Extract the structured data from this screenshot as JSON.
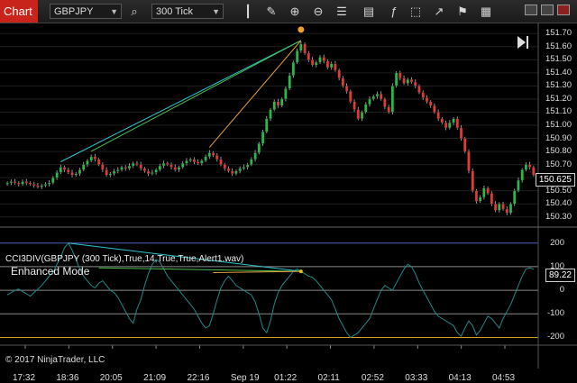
{
  "toolbar": {
    "tab_label": "Chart",
    "instrument": "GBPJPY",
    "interval": "300 Tick"
  },
  "colors": {
    "background": "#000000",
    "up_candle": "#2db84a",
    "down_candle": "#e53935",
    "oscillator": "#1d8a8a",
    "divergence_cyan": "#2cc6d0",
    "divergence_green": "#49c04a",
    "divergence_orange": "#e8a040",
    "level_200": "#5060c0",
    "level_minus200": "#d4a020",
    "accent": "#c9241c"
  },
  "price_axis": {
    "labels": [
      "151.70",
      "151.60",
      "151.50",
      "151.40",
      "151.30",
      "151.20",
      "151.10",
      "151.00",
      "150.90",
      "150.80",
      "150.70",
      "150.60",
      "150.50",
      "150.40",
      "150.30"
    ],
    "current_price": "150.625"
  },
  "indicator": {
    "title": "CCI3DIV(GBPJPY (300 Tick),True,14,True,True,Alert1.wav)",
    "mode": "Enhanced Mode",
    "levels": [
      "200",
      "100",
      "0",
      "-100",
      "-200"
    ],
    "current_value": "89.22"
  },
  "time_axis": {
    "labels": [
      "17:32",
      "18:36",
      "20:05",
      "21:09",
      "22:16",
      "Sep 19",
      "01:22",
      "02:11",
      "02:52",
      "03:33",
      "04:13",
      "04:53"
    ]
  },
  "copyright": "© 2017 NinjaTrader, LLC",
  "chart_data": {
    "type": "candlestick",
    "instrument": "GBPJPY",
    "ylim": [
      150.25,
      151.75
    ],
    "closes": [
      150.56,
      150.57,
      150.56,
      150.55,
      150.57,
      150.56,
      150.55,
      150.54,
      150.53,
      150.54,
      150.55,
      150.56,
      150.6,
      150.64,
      150.68,
      150.66,
      150.64,
      150.62,
      150.63,
      150.66,
      150.7,
      150.73,
      150.76,
      150.74,
      150.7,
      150.66,
      150.62,
      150.63,
      150.65,
      150.66,
      150.68,
      150.67,
      150.69,
      150.71,
      150.7,
      150.67,
      150.65,
      150.63,
      150.64,
      150.66,
      150.69,
      150.71,
      150.7,
      150.68,
      150.66,
      150.68,
      150.71,
      150.73,
      150.74,
      150.72,
      150.71,
      150.73,
      150.76,
      150.79,
      150.77,
      150.74,
      150.7,
      150.67,
      150.65,
      150.63,
      150.65,
      150.67,
      150.68,
      150.7,
      150.74,
      150.79,
      150.86,
      150.95,
      151.05,
      151.12,
      151.18,
      151.15,
      151.2,
      151.28,
      151.38,
      151.48,
      151.57,
      151.62,
      151.55,
      151.5,
      151.46,
      151.48,
      151.52,
      151.49,
      151.44,
      151.47,
      151.42,
      151.36,
      151.3,
      151.26,
      151.18,
      151.12,
      151.05,
      151.1,
      151.16,
      151.2,
      151.22,
      151.24,
      151.2,
      151.14,
      151.1,
      151.3,
      151.4,
      151.36,
      151.32,
      151.35,
      151.33,
      151.3,
      151.25,
      151.21,
      151.18,
      151.15,
      151.1,
      151.05,
      151.02,
      150.98,
      151.02,
      151.05,
      150.98,
      150.9,
      150.8,
      150.65,
      150.5,
      150.42,
      150.45,
      150.52,
      150.48,
      150.4,
      150.35,
      150.4,
      150.36,
      150.33,
      150.4,
      150.5,
      150.58,
      150.66,
      150.7,
      150.68,
      150.62
    ],
    "oscillator": [
      -20,
      -10,
      0,
      5,
      -5,
      -15,
      -25,
      -10,
      5,
      20,
      40,
      60,
      75,
      110,
      140,
      180,
      200,
      170,
      130,
      90,
      60,
      40,
      20,
      10,
      30,
      40,
      20,
      0,
      -10,
      -30,
      -60,
      -90,
      -120,
      -140,
      -80,
      -40,
      20,
      70,
      110,
      130,
      120,
      90,
      60,
      40,
      20,
      0,
      -20,
      -40,
      -60,
      -80,
      -110,
      -140,
      -160,
      -150,
      -100,
      -40,
      10,
      40,
      60,
      40,
      20,
      10,
      0,
      -10,
      -20,
      -50,
      -100,
      -160,
      -180,
      -130,
      -60,
      -10,
      20,
      40,
      60,
      80,
      90,
      80,
      70,
      60,
      55,
      40,
      20,
      0,
      -20,
      -40,
      -80,
      -120,
      -150,
      -180,
      -200,
      -190,
      -180,
      -160,
      -140,
      -120,
      -80,
      -40,
      0,
      20,
      10,
      0,
      30,
      60,
      90,
      110,
      100,
      70,
      30,
      0,
      -30,
      -60,
      -90,
      -110,
      -120,
      -130,
      -140,
      -150,
      -180,
      -195,
      -160,
      -130,
      -150,
      -190,
      -170,
      -140,
      -110,
      -120,
      -140,
      -160,
      -120,
      -90,
      -60,
      -20,
      20,
      60,
      90,
      95,
      89
    ]
  }
}
